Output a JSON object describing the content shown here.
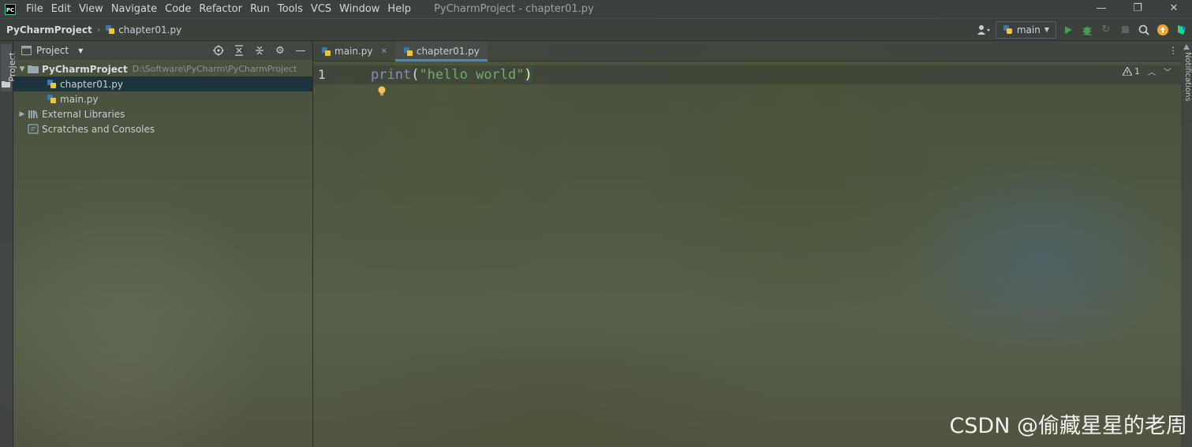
{
  "menubar": {
    "logo": "PC",
    "items": [
      "File",
      "Edit",
      "View",
      "Navigate",
      "Code",
      "Refactor",
      "Run",
      "Tools",
      "VCS",
      "Window",
      "Help"
    ],
    "window_title": "PyCharmProject - chapter01.py",
    "window_controls": [
      "—",
      "❐",
      "✕"
    ]
  },
  "navbar": {
    "project": "PyCharmProject",
    "file": "chapter01.py",
    "run_config": "main"
  },
  "left_stripe": {
    "label": "Project"
  },
  "project_panel": {
    "title": "Project",
    "tree": [
      {
        "label": "PyCharmProject",
        "path": "D:\\Software\\PyCharm\\PyCharmProject"
      },
      {
        "label": "chapter01.py"
      },
      {
        "label": "main.py"
      },
      {
        "label": "External Libraries"
      },
      {
        "label": "Scratches and Consoles"
      }
    ]
  },
  "editor": {
    "tabs": [
      {
        "label": "main.py"
      },
      {
        "label": "chapter01.py"
      }
    ],
    "line_number": "1",
    "code": {
      "keyword": "print",
      "open": "(",
      "string": "\"hello world\"",
      "close": ")"
    },
    "warnings": "1"
  },
  "right_stripe": {
    "label": "Notifications"
  },
  "watermark": "CSDN @偷藏星星的老周",
  "colors": {
    "accent": "#4a88c7",
    "keyword": "#8888c6",
    "string": "#6aab73",
    "selection": "#0d293e"
  }
}
